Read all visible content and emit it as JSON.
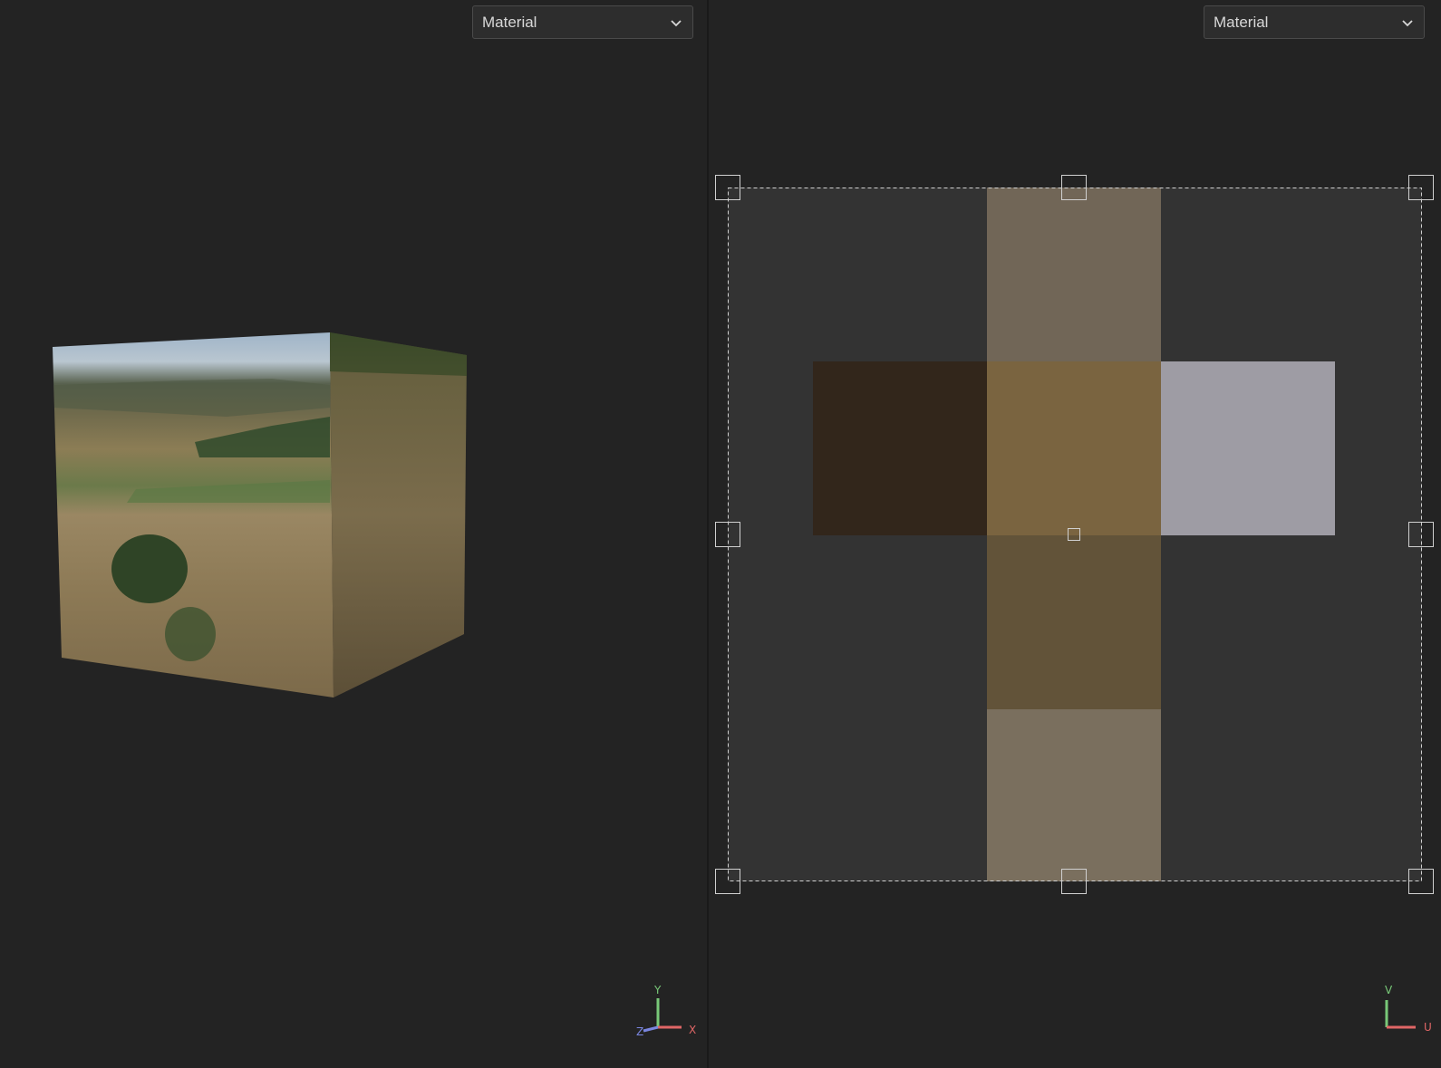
{
  "viewport3d": {
    "material_dropdown": {
      "label": "Material"
    },
    "axes": {
      "y": "Y",
      "x": "X",
      "z": "Z"
    }
  },
  "uv_editor": {
    "material_dropdown": {
      "label": "Material"
    },
    "axes": {
      "v": "V",
      "u": "U"
    }
  },
  "colors": {
    "background": "#232323",
    "uv_area": "#333333",
    "x_axis": "#e06666",
    "y_axis": "#78c878",
    "z_axis": "#7a86e0"
  }
}
